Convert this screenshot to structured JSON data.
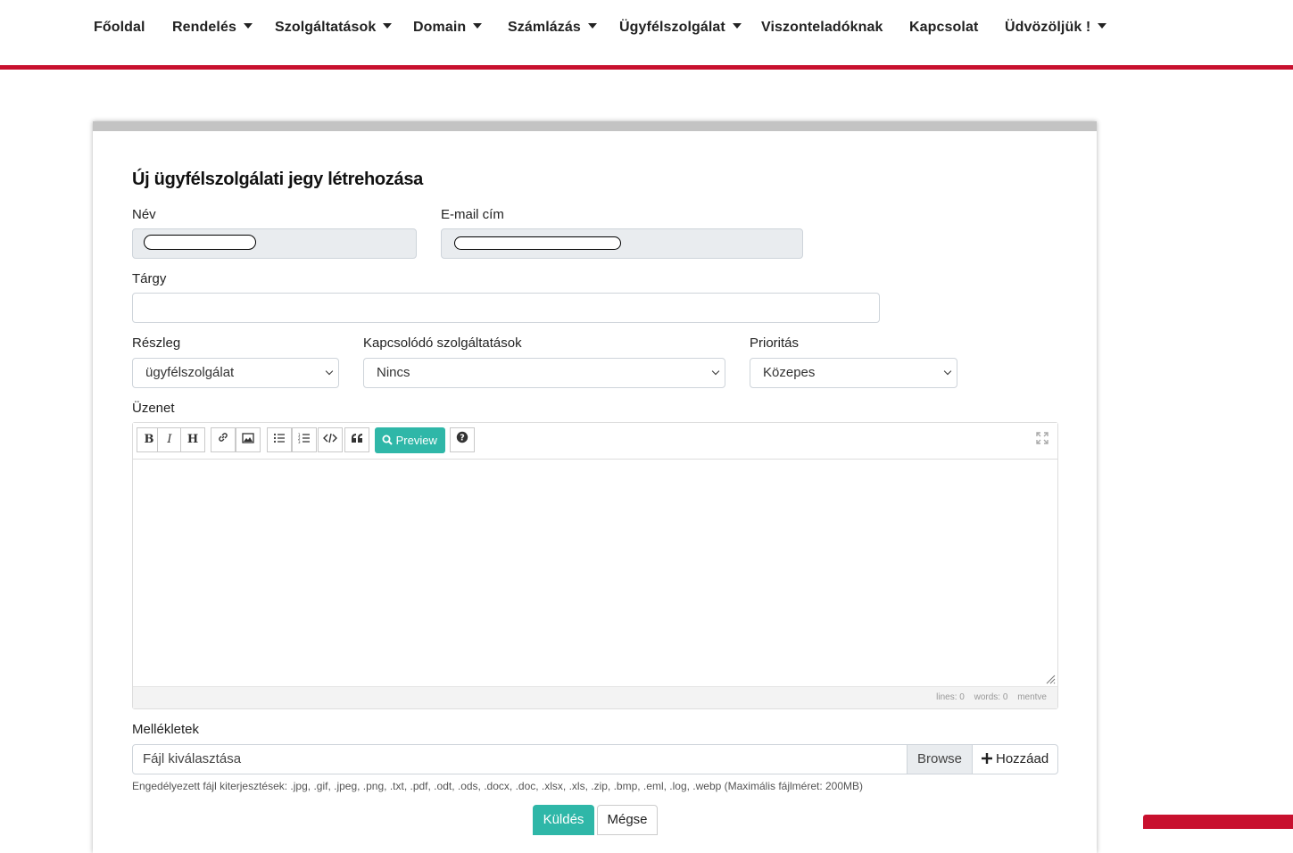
{
  "nav": {
    "items": [
      {
        "label": "Főoldal",
        "has_dropdown": false
      },
      {
        "label": "Rendelés",
        "has_dropdown": true
      },
      {
        "label": "Szolgáltatások",
        "has_dropdown": true
      },
      {
        "label": "Domain",
        "has_dropdown": true
      },
      {
        "label": "Számlázás",
        "has_dropdown": true
      },
      {
        "label": "Ügyfélszolgálat",
        "has_dropdown": true
      },
      {
        "label": "Viszonteladóknak",
        "has_dropdown": false
      },
      {
        "label": "Kapcsolat",
        "has_dropdown": false
      },
      {
        "label": "Üdvözöljük !",
        "has_dropdown": true
      }
    ],
    "accent_color": "#c8102e"
  },
  "form": {
    "title": "Új ügyfélszolgálati jegy létrehozása",
    "name_label": "Név",
    "name_value": "",
    "email_label": "E-mail cím",
    "email_value": "",
    "subject_label": "Tárgy",
    "subject_value": "",
    "department_label": "Részleg",
    "department_value": "ügyfélszolgálat",
    "related_label": "Kapcsolódó szolgáltatások",
    "related_value": "Nincs",
    "priority_label": "Prioritás",
    "priority_value": "Közepes",
    "message_label": "Üzenet",
    "editor": {
      "preview_label": "Preview",
      "status_lines": "lines: 0",
      "status_words": "words: 0",
      "status_saved": "mentve",
      "tools": [
        "bold-icon",
        "italic-icon",
        "heading-icon",
        "link-icon",
        "image-icon",
        "unordered-list-icon",
        "ordered-list-icon",
        "code-icon",
        "quote-icon",
        "search-icon",
        "help-icon",
        "fullscreen-icon"
      ]
    },
    "attachments_label": "Mellékletek",
    "file_placeholder": "Fájl kiválasztása",
    "browse_label": "Browse",
    "add_label": "Hozzáad",
    "allowed_hint": "Engedélyezett fájl kiterjesztések: .jpg, .gif, .jpeg, .png, .txt, .pdf, .odt, .ods, .docx, .doc, .xlsx, .xls, .zip, .bmp, .eml, .log, .webp (Maximális fájlméret: 200MB)",
    "submit_label": "Küldés",
    "cancel_label": "Mégse"
  },
  "colors": {
    "primary_teal": "#2fb7a8",
    "brand_red": "#c8102e"
  }
}
